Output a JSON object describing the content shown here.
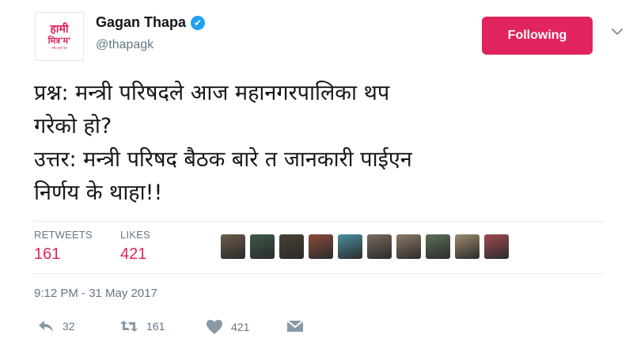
{
  "profile": {
    "avatar_line1": "हामी",
    "avatar_line2": "मित्र'म'",
    "avatar_line3": "सबै अट्ने देश",
    "name": "Gagan Thapa",
    "verified_icon": "✔",
    "handle": "@thapagk"
  },
  "follow_button": {
    "label": "Following",
    "color": "#e0245e"
  },
  "tweet": {
    "lines": [
      "प्रश्न: मन्त्री परिषदले आज महानगरपालिका थप",
      "गरेको हो?",
      "उत्तर: मन्त्री परिषद बैठक बारे त जानकारी पाईएन",
      "निर्णय के थाहा!!"
    ]
  },
  "stats": {
    "retweets_label": "RETWEETS",
    "retweets_count": "161",
    "likes_label": "LIKES",
    "likes_count": "421"
  },
  "likers": [
    {
      "name": "liker-1",
      "color": "#6b5b4b"
    },
    {
      "name": "liker-2",
      "color": "#3d5a4a"
    },
    {
      "name": "liker-3",
      "color": "#4a3f35"
    },
    {
      "name": "liker-4",
      "color": "#8a4c3c"
    },
    {
      "name": "liker-5",
      "color": "#4a8fa0"
    },
    {
      "name": "liker-6",
      "color": "#7a6a5e"
    },
    {
      "name": "liker-7",
      "color": "#8c7a66"
    },
    {
      "name": "liker-8",
      "color": "#5e6e5a"
    },
    {
      "name": "liker-9",
      "color": "#9c8a6e"
    },
    {
      "name": "liker-10",
      "color": "#a04a52"
    }
  ],
  "timestamp": "9:12 PM - 31 May 2017",
  "actions": {
    "reply_count": "32",
    "retweet_count": "161",
    "like_count": "421"
  },
  "colors": {
    "accent": "#e0245e",
    "muted": "#657786",
    "verified": "#1da1f2"
  }
}
